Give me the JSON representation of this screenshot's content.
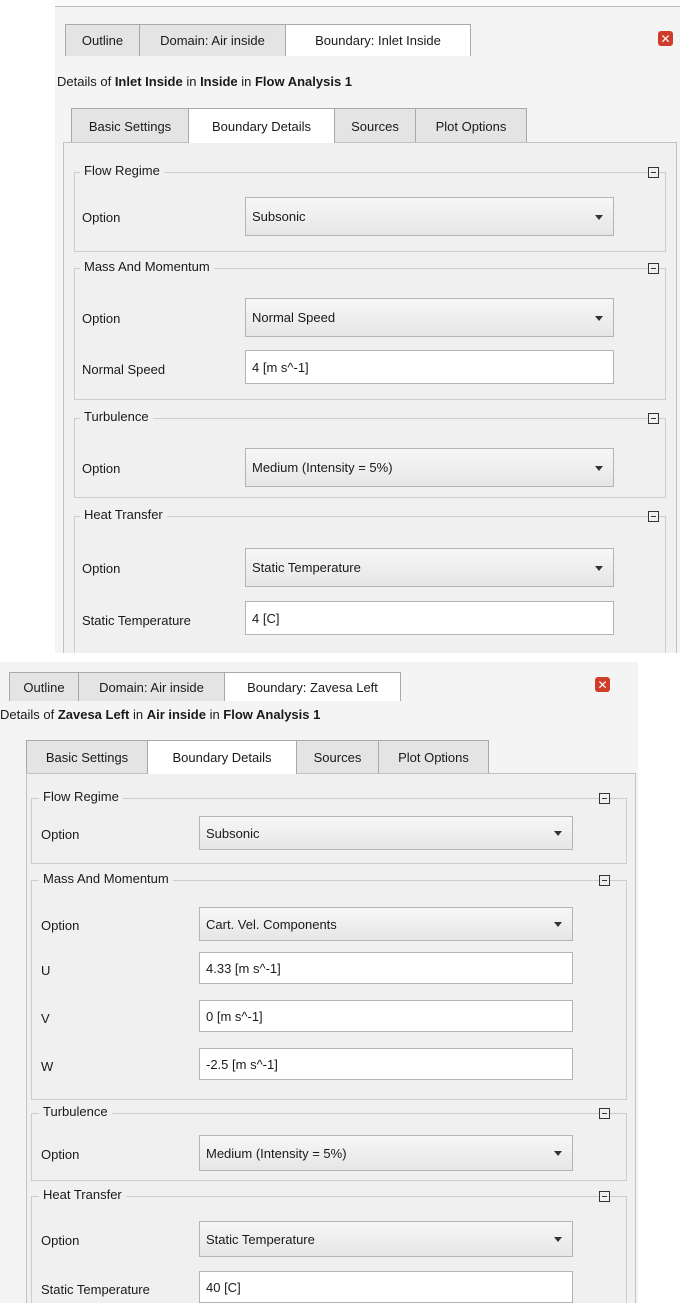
{
  "panel1": {
    "tabs": [
      "Outline",
      "Domain: Air inside",
      "Boundary: Inlet Inside"
    ],
    "details": {
      "prefix": "Details of ",
      "object": "Inlet Inside",
      "in1": " in ",
      "domain": "Inside",
      "in2": " in ",
      "analysis": "Flow Analysis 1"
    },
    "subtabs": [
      "Basic Settings",
      "Boundary Details",
      "Sources",
      "Plot Options"
    ],
    "flow_regime": {
      "title": "Flow Regime",
      "option_label": "Option",
      "option_value": "Subsonic"
    },
    "mass": {
      "title": "Mass And Momentum",
      "option_label": "Option",
      "option_value": "Normal Speed",
      "speed_label": "Normal Speed",
      "speed_value": "4 [m s^-1]"
    },
    "turbulence": {
      "title": "Turbulence",
      "option_label": "Option",
      "option_value": "Medium (Intensity = 5%)"
    },
    "heat": {
      "title": "Heat Transfer",
      "option_label": "Option",
      "option_value": "Static Temperature",
      "temp_label": "Static Temperature",
      "temp_value": "4 [C]"
    }
  },
  "panel2": {
    "tabs": [
      "Outline",
      "Domain: Air inside",
      "Boundary: Zavesa Left"
    ],
    "details": {
      "prefix": "Details of ",
      "object": "Zavesa Left",
      "in1": " in ",
      "domain": "Air inside",
      "in2": " in ",
      "analysis": "Flow Analysis 1"
    },
    "subtabs": [
      "Basic Settings",
      "Boundary Details",
      "Sources",
      "Plot Options"
    ],
    "flow_regime": {
      "title": "Flow Regime",
      "option_label": "Option",
      "option_value": "Subsonic"
    },
    "mass": {
      "title": "Mass And Momentum",
      "option_label": "Option",
      "option_value": "Cart. Vel. Components",
      "u_label": "U",
      "u_value": "4.33 [m s^-1]",
      "v_label": "V",
      "v_value": "0 [m s^-1]",
      "w_label": "W",
      "w_value": "-2.5 [m s^-1]"
    },
    "turbulence": {
      "title": "Turbulence",
      "option_label": "Option",
      "option_value": "Medium (Intensity = 5%)"
    },
    "heat": {
      "title": "Heat Transfer",
      "option_label": "Option",
      "option_value": "Static Temperature",
      "temp_label": "Static Temperature",
      "temp_value": "40 [C]"
    }
  },
  "icons": {
    "close": "close-icon",
    "collapse": "collapse-icon",
    "dropdown": "chevron-down-icon"
  },
  "colors": {
    "close_button": "#cf3d2a",
    "panel_bg": "#f0f0f0",
    "active_tab": "#ffffff"
  }
}
